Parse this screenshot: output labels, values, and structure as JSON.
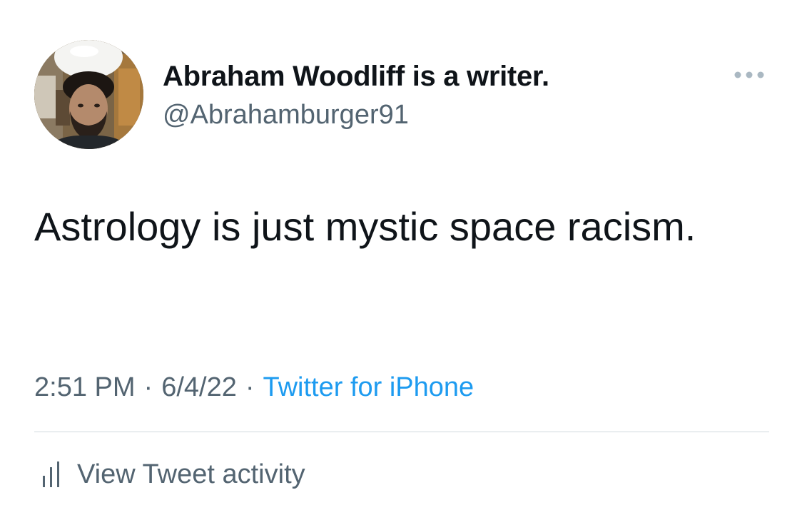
{
  "author": {
    "display_name": "Abraham Woodliff is a writer.",
    "handle": "@Abrahamburger91",
    "avatar_icon": "profile-photo"
  },
  "more_icon": "more-horizontal-icon",
  "tweet": {
    "text": "Astrology is just mystic space racism."
  },
  "meta": {
    "time": "2:51 PM",
    "separator": "·",
    "date": "6/4/22",
    "source": "Twitter for iPhone"
  },
  "activity": {
    "label": "View Tweet activity",
    "icon": "analytics-bars-icon"
  },
  "colors": {
    "text_primary": "#0f1419",
    "text_secondary": "#536471",
    "link": "#1d9bf0",
    "divider": "#cfd9de",
    "more_dots": "#aab8c2"
  }
}
